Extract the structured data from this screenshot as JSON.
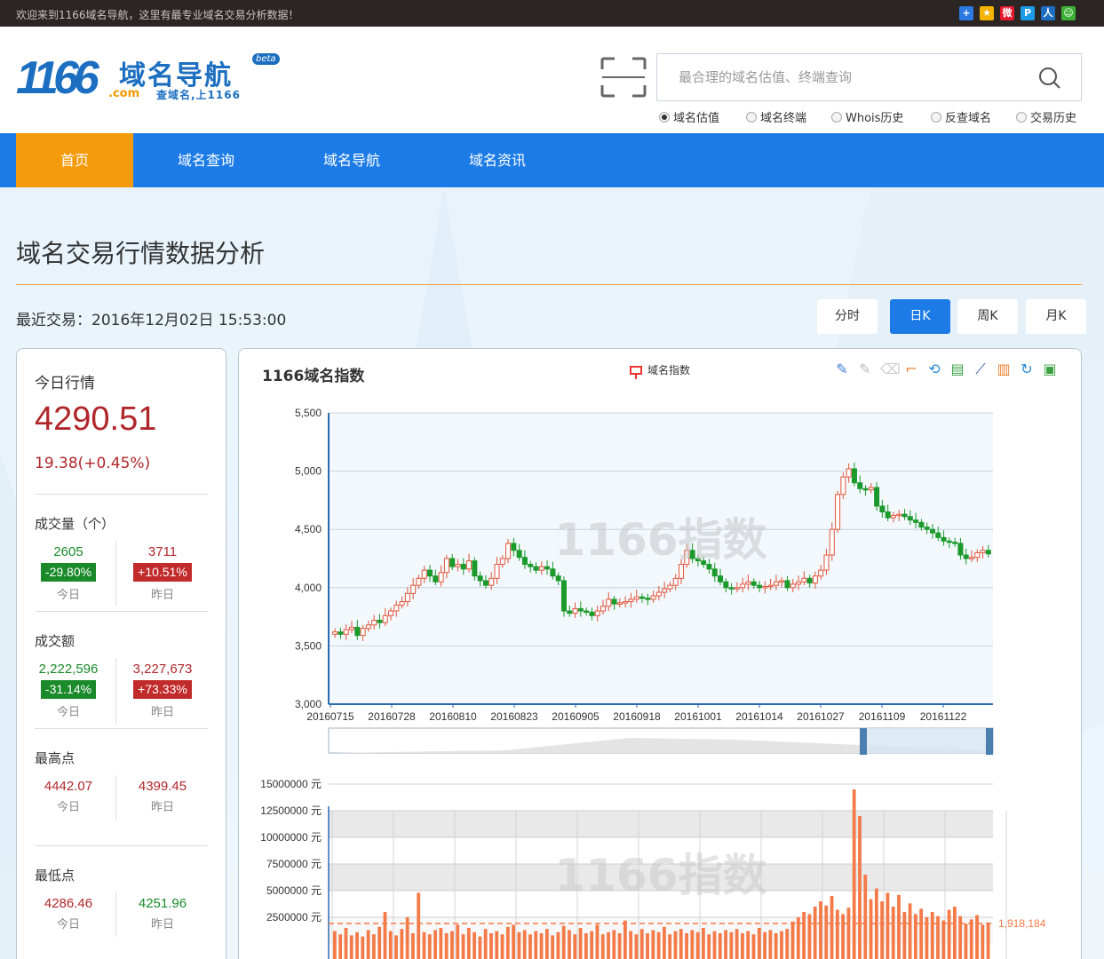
{
  "topbar": {
    "welcome": "欢迎来到1166域名导航，这里有最专业域名交易分析数据！",
    "share_icons": [
      {
        "icon": "plus-share-icon",
        "color": "#2a7ae2"
      },
      {
        "icon": "qzone-share-icon",
        "color": "#f5b300"
      },
      {
        "icon": "weibo-share-icon",
        "color": "#e6162d"
      },
      {
        "icon": "tqq-share-icon",
        "color": "#1c9be6"
      },
      {
        "icon": "renren-share-icon",
        "color": "#1d6ec1"
      },
      {
        "icon": "wechat-share-icon",
        "color": "#3cb034"
      }
    ]
  },
  "logo": {
    "number": "1166",
    "name": "域名导航",
    "badge": "beta",
    "domain": ".com",
    "slogan": "查域名,上1166"
  },
  "search": {
    "placeholder": "最合理的域名估值、终端查询",
    "options": [
      "域名估值",
      "域名终端",
      "Whois历史",
      "反查域名",
      "交易历史"
    ],
    "selected": "域名估值"
  },
  "nav": {
    "items": [
      "首页",
      "域名查询",
      "域名导航",
      "域名资讯"
    ],
    "active": "首页",
    "color": "#1c7be6",
    "active_color": "#f59a0a"
  },
  "page": {
    "title": "域名交易行情数据分析",
    "last_trade_label": "最近交易：",
    "last_trade_time": "2016年12月02日 15:53:00",
    "k_buttons": [
      "分时",
      "日K",
      "周K",
      "月K"
    ],
    "k_active": "日K"
  },
  "today": {
    "title": "今日行情",
    "price": "4290.51",
    "change": "19.38(+0.45%)",
    "sections": [
      {
        "label": "成交量（个）",
        "today": "2605",
        "today_badge": "-29.80%",
        "yesterday": "3711",
        "yesterday_badge": "+10.51%",
        "today_label": "今日",
        "yesterday_label": "昨日"
      },
      {
        "label": "成交额",
        "today": "2,222,596",
        "today_badge": "-31.14%",
        "yesterday": "3,227,673",
        "yesterday_badge": "+73.33%",
        "today_label": "今日",
        "yesterday_label": "昨日"
      },
      {
        "label": "最高点",
        "today": "4442.07",
        "yesterday": "4399.45",
        "today_label": "今日",
        "yesterday_label": "昨日"
      },
      {
        "label": "最低点",
        "today": "4286.46",
        "yesterday": "4251.96",
        "today_label": "今日",
        "yesterday_label": "昨日"
      }
    ]
  },
  "chart_panel": {
    "title": "1166域名指数",
    "legend": "域名指数",
    "watermark": "1166指数",
    "tools": [
      "pen-icon",
      "pen-light-icon",
      "eraser-icon",
      "crop-icon",
      "refresh-icon",
      "data-view-icon",
      "line-chart-icon",
      "bar-chart-icon",
      "restore-icon",
      "save-image-icon"
    ]
  },
  "chart_data": [
    {
      "type": "candlestick",
      "title": "1166域名指数",
      "series_name": "域名指数",
      "y_ticks": [
        "3,000",
        "3,500",
        "4,000",
        "4,500",
        "5,000",
        "5,500"
      ],
      "ylim": [
        3000,
        5500
      ],
      "x_ticks": [
        "20160715",
        "20160728",
        "20160810",
        "20160823",
        "20160905",
        "20160918",
        "20161001",
        "20161014",
        "20161027",
        "20161109",
        "20161122"
      ],
      "grid": true,
      "up_color": "#e2553b",
      "down_color": "#1a9a2a",
      "close_series": [
        3620,
        3600,
        3640,
        3660,
        3590,
        3650,
        3680,
        3720,
        3700,
        3760,
        3800,
        3850,
        3880,
        3950,
        4020,
        4080,
        4150,
        4100,
        4050,
        4130,
        4250,
        4180,
        4200,
        4160,
        4230,
        4100,
        4060,
        4020,
        4080,
        4200,
        4250,
        4380,
        4320,
        4260,
        4200,
        4180,
        4150,
        4180,
        4160,
        4100,
        4060,
        3800,
        3780,
        3820,
        3800,
        3790,
        3760,
        3800,
        3840,
        3900,
        3860,
        3870,
        3880,
        3900,
        3920,
        3910,
        3900,
        3930,
        3960,
        3990,
        4020,
        4080,
        4200,
        4320,
        4250,
        4230,
        4200,
        4160,
        4100,
        4050,
        4000,
        3990,
        4000,
        4030,
        4050,
        4020,
        4000,
        4010,
        4020,
        4050,
        4060,
        4000,
        4030,
        4050,
        4080,
        4040,
        4100,
        4150,
        4280,
        4500,
        4800,
        4950,
        5020,
        4900,
        4850,
        4840,
        4860,
        4700,
        4650,
        4600,
        4620,
        4630,
        4610,
        4580,
        4560,
        4520,
        4500,
        4470,
        4430,
        4400,
        4390,
        4380,
        4280,
        4250,
        4260,
        4300,
        4320,
        4290
      ]
    },
    {
      "type": "bar",
      "title": "",
      "y_ticks": [
        "2500000 元",
        "5000000 元",
        "7500000 元",
        "10000000 元",
        "12500000 元",
        "15000000 元"
      ],
      "ylim": [
        0,
        15000000
      ],
      "mark_line": "1,918,184",
      "bar_color": "#f47a48",
      "values": [
        1200000,
        900000,
        1500000,
        800000,
        1100000,
        700000,
        1300000,
        900000,
        1600000,
        3000000,
        1200000,
        800000,
        1400000,
        2500000,
        1000000,
        4800000,
        1100000,
        900000,
        1300000,
        1500000,
        1000000,
        1200000,
        1800000,
        900000,
        1500000,
        1100000,
        700000,
        1400000,
        1000000,
        1200000,
        900000,
        1600000,
        1800000,
        1100000,
        1300000,
        900000,
        1200000,
        1000000,
        1400000,
        800000,
        1100000,
        1700000,
        1300000,
        900000,
        1500000,
        1000000,
        1200000,
        1800000,
        900000,
        1100000,
        1300000,
        1000000,
        2200000,
        1200000,
        900000,
        1400000,
        1000000,
        1300000,
        1100000,
        1600000,
        900000,
        1200000,
        1400000,
        1000000,
        1300000,
        1100000,
        1500000,
        900000,
        1200000,
        1000000,
        1300000,
        1100000,
        1400000,
        1000000,
        1200000,
        900000,
        1500000,
        1100000,
        1300000,
        1000000,
        1200000,
        1400000,
        2100000,
        2500000,
        3000000,
        2800000,
        3500000,
        4000000,
        3600000,
        4500000,
        3200000,
        2800000,
        3400000,
        14500000,
        12000000,
        6500000,
        4200000,
        5200000,
        4000000,
        4800000,
        3500000,
        4600000,
        3000000,
        3800000,
        2800000,
        3300000,
        2500000,
        3000000,
        2600000,
        2200000,
        3200000,
        3500000,
        2600000,
        1900000,
        2300000,
        2700000,
        1800000,
        2000000
      ]
    }
  ]
}
